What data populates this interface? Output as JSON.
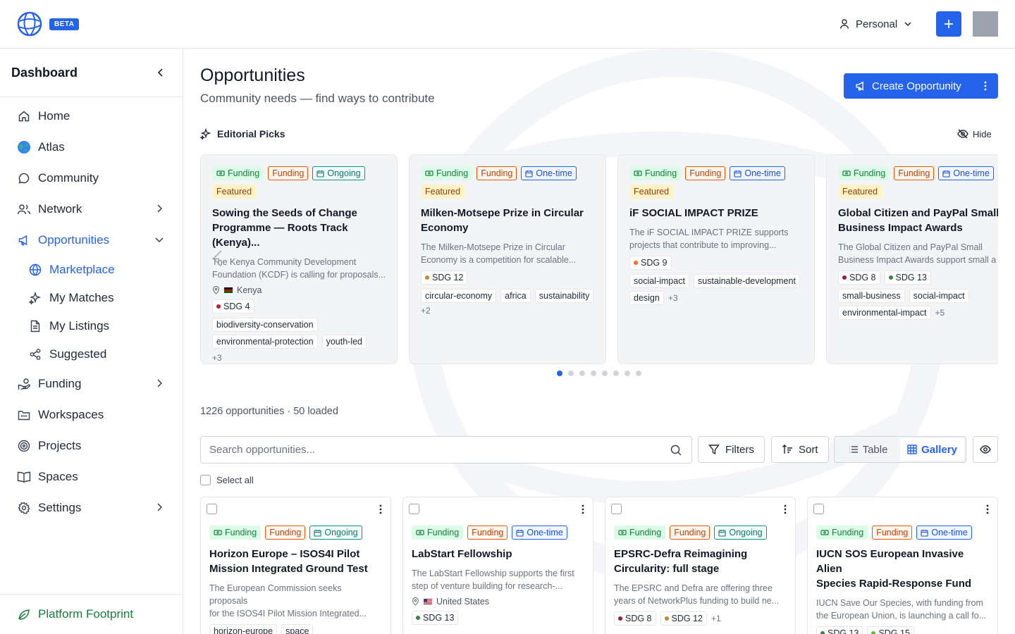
{
  "header": {
    "beta_label": "BETA",
    "account_label": "Personal"
  },
  "sidebar": {
    "title": "Dashboard",
    "items": [
      {
        "label": "Home"
      },
      {
        "label": "Atlas"
      },
      {
        "label": "Community"
      },
      {
        "label": "Network"
      },
      {
        "label": "Opportunities"
      },
      {
        "label": "Funding"
      },
      {
        "label": "Workspaces"
      },
      {
        "label": "Projects"
      },
      {
        "label": "Spaces"
      },
      {
        "label": "Settings"
      }
    ],
    "sub_items": [
      {
        "label": "Marketplace"
      },
      {
        "label": "My Matches"
      },
      {
        "label": "My Listings"
      },
      {
        "label": "Suggested"
      }
    ],
    "footer_label": "Platform Footprint"
  },
  "page": {
    "title": "Opportunities",
    "subtitle": "Community needs — find ways to contribute",
    "create_label": "Create Opportunity",
    "editorial_label": "Editorial Picks",
    "hide_label": "Hide",
    "count_text": "1226 opportunities · 50 loaded",
    "search_placeholder": "Search opportunities...",
    "filters_label": "Filters",
    "sort_label": "Sort",
    "table_label": "Table",
    "gallery_label": "Gallery",
    "select_all_label": "Select all",
    "carousel_dots": 8,
    "active_dot": 0
  },
  "tag_labels": {
    "funding_green": "Funding",
    "funding_orange": "Funding",
    "ongoing": "Ongoing",
    "onetime": "One-time",
    "featured": "Featured"
  },
  "colors": {
    "accent": "#2563eb",
    "sdg4": "#c5192d",
    "sdg8": "#a21942",
    "sdg9": "#fd6925",
    "sdg12": "#bf8b2e",
    "sdg13": "#3f7e44",
    "sdg15": "#56c02b"
  },
  "picks": [
    {
      "title_1": "Sowing the Seeds of Change",
      "title_2": "Programme — Roots Track (Kenya)...",
      "desc_1": "The Kenya Community Development",
      "desc_2": "Foundation (KCDF) is calling for proposals...",
      "location": "Kenya",
      "sdgs": [
        "SDG 4"
      ],
      "chips": [
        "biodiversity-conservation",
        "environmental-protection",
        "youth-led"
      ],
      "more": "+3"
    },
    {
      "title_1": "Milken-Motsepe Prize in Circular",
      "title_2": "Economy",
      "desc_1": "The Milken-Motsepe Prize in Circular",
      "desc_2": "Economy is a competition for scalable...",
      "sdgs": [
        "SDG 12"
      ],
      "chips": [
        "circular-economy",
        "africa",
        "sustainability"
      ],
      "more": "+2"
    },
    {
      "title_1": "iF SOCIAL IMPACT PRIZE",
      "desc_1": "The iF SOCIAL IMPACT PRIZE supports",
      "desc_2": "projects that contribute to improving...",
      "sdgs": [
        "SDG 9"
      ],
      "chips": [
        "social-impact",
        "sustainable-development",
        "design"
      ],
      "more": "+3"
    },
    {
      "title_1": "Global Citizen and PayPal Small",
      "title_2": "Business Impact Awards",
      "desc_1": "The Global Citizen and PayPal Small",
      "desc_2": "Business Impact Awards support small a",
      "sdgs": [
        "SDG 8",
        "SDG 13"
      ],
      "chips": [
        "small-business",
        "social-impact",
        "environmental-impact"
      ],
      "more": "+5"
    }
  ],
  "gallery": [
    {
      "title_1": "Horizon Europe – ISOS4I Pilot",
      "title_2": "Mission Integrated Ground Test",
      "desc_1": "The European Commission seeks proposals",
      "desc_2": "for the ISOS4I Pilot Mission Integrated...",
      "chips": [
        "horizon-europe",
        "space"
      ]
    },
    {
      "title_1": "LabStart Fellowship",
      "desc_1": "The LabStart Fellowship supports the first",
      "desc_2": "step of venture building for research-...",
      "location": "United States",
      "sdgs": [
        "SDG 13"
      ]
    },
    {
      "title_1": "EPSRC-Defra Reimagining",
      "title_2": "Circularity: full stage",
      "desc_1": "The EPSRC and Defra are offering three",
      "desc_2": "years of NetworkPlus funding to build ne...",
      "sdgs": [
        "SDG 8",
        "SDG 12"
      ],
      "more": "+1"
    },
    {
      "title_1": "IUCN SOS European Invasive Alien",
      "title_2": "Species Rapid-Response Fund",
      "desc_1": "IUCN Save Our Species, with funding from",
      "desc_2": "the European Union, is launching a call fo...",
      "sdgs": [
        "SDG 13",
        "SDG 15"
      ]
    }
  ]
}
